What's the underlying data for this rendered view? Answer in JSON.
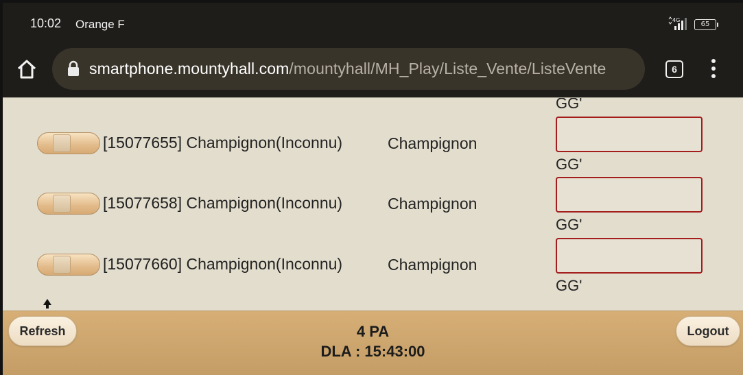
{
  "status_bar": {
    "time": "10:02",
    "carrier": "Orange F",
    "network": "4G",
    "battery": "65"
  },
  "browser": {
    "url_host": "smartphone.mountyhall.com",
    "url_path": "/mountyhall/MH_Play/Liste_Vente/ListeVente",
    "tab_count": "6"
  },
  "page": {
    "currency_label": "GG'",
    "items": [
      {
        "label": "[15077655] Champignon(Inconnu)",
        "type": "Champignon",
        "price": ""
      },
      {
        "label": "[15077658] Champignon(Inconnu)",
        "type": "Champignon",
        "price": ""
      },
      {
        "label": "[15077660] Champignon(Inconnu)",
        "type": "Champignon",
        "price": ""
      }
    ]
  },
  "footer": {
    "refresh_label": "Refresh",
    "logout_label": "Logout",
    "pa": "4 PA",
    "dla": "DLA : 15:43:00"
  },
  "colors": {
    "page_bg": "#e2ddcd",
    "footer_bg": "#d6ae76",
    "input_border": "#a31d1d"
  }
}
